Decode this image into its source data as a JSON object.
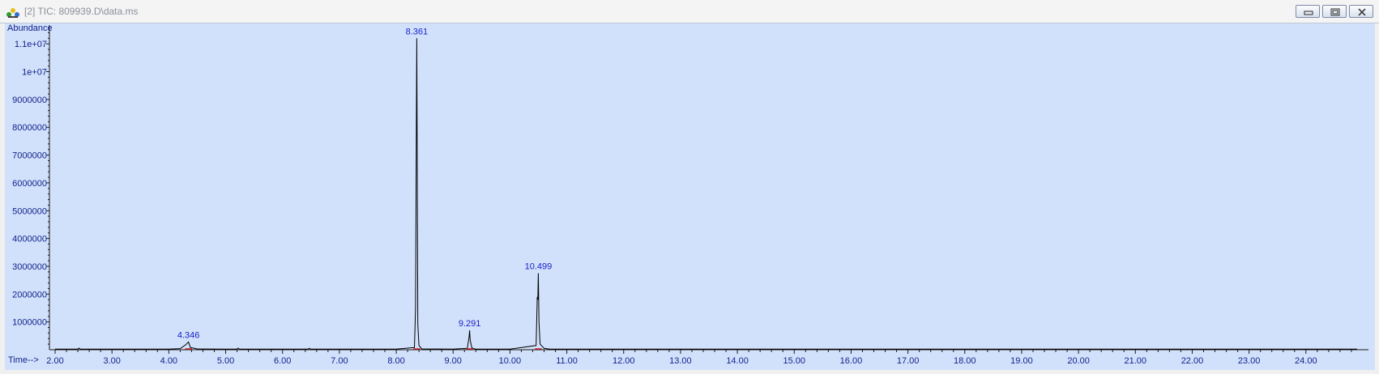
{
  "window": {
    "title": "[2] TIC: 809939.D\\data.ms",
    "minimize_icon": "minimize-icon",
    "restore_icon": "restore-icon",
    "close_icon": "close-icon"
  },
  "colors": {
    "plot_bg": "#d1e1fb",
    "trace": "#000000",
    "axis_text": "#0f1f8a",
    "peak_label": "#1a22c8",
    "baseline_marker": "#d02020"
  },
  "chart_data": {
    "type": "line",
    "title": "",
    "ylabel": "Abundance",
    "xlabel": "Time-->",
    "xlim": [
      1.9,
      25.1
    ],
    "ylim": [
      0,
      11500000
    ],
    "x_ticks": [
      2,
      3,
      4,
      5,
      6,
      7,
      8,
      9,
      10,
      11,
      12,
      13,
      14,
      15,
      16,
      17,
      18,
      19,
      20,
      21,
      22,
      23,
      24
    ],
    "x_tick_labels": [
      "2.00",
      "3.00",
      "4.00",
      "5.00",
      "6.00",
      "7.00",
      "8.00",
      "9.00",
      "10.00",
      "11.00",
      "12.00",
      "13.00",
      "14.00",
      "15.00",
      "16.00",
      "17.00",
      "18.00",
      "19.00",
      "20.00",
      "21.00",
      "22.00",
      "23.00",
      "24.00"
    ],
    "y_ticks": [
      1000000,
      2000000,
      3000000,
      4000000,
      5000000,
      6000000,
      7000000,
      8000000,
      9000000,
      10000000,
      11000000
    ],
    "y_tick_labels": [
      "1000000",
      "2000000",
      "3000000",
      "4000000",
      "5000000",
      "6000000",
      "7000000",
      "8000000",
      "9000000",
      "1e+07",
      "1.1e+07"
    ],
    "peak_labels": [
      {
        "x": 4.346,
        "y": 280000,
        "label": "4.346"
      },
      {
        "x": 8.361,
        "y": 11200000,
        "label": "8.361"
      },
      {
        "x": 9.291,
        "y": 700000,
        "label": "9.291"
      },
      {
        "x": 10.499,
        "y": 2750000,
        "label": "10.499"
      }
    ],
    "series": [
      {
        "x": [
          2.0,
          2.4,
          2.42,
          2.44,
          3.0,
          4.0,
          4.2,
          4.3,
          4.346,
          4.38,
          4.5,
          5.0,
          5.2,
          5.22,
          5.24,
          6.0,
          6.45,
          6.47,
          6.49,
          7.0,
          8.0,
          8.32,
          8.34,
          8.35,
          8.361,
          8.37,
          8.38,
          8.4,
          8.45,
          9.0,
          9.25,
          9.28,
          9.291,
          9.3,
          9.33,
          9.4,
          10.0,
          10.46,
          10.48,
          10.49,
          10.499,
          10.51,
          10.53,
          10.6,
          10.7,
          11.0,
          12.0,
          24.9
        ],
        "y": [
          20000,
          20000,
          60000,
          20000,
          20000,
          20000,
          40000,
          180000,
          280000,
          80000,
          30000,
          20000,
          20000,
          60000,
          20000,
          20000,
          20000,
          50000,
          20000,
          20000,
          20000,
          80000,
          1500000,
          6300000,
          11200000,
          6400000,
          900000,
          150000,
          30000,
          20000,
          50000,
          450000,
          700000,
          350000,
          60000,
          20000,
          20000,
          150000,
          1900000,
          1800000,
          2750000,
          1000000,
          200000,
          50000,
          20000,
          20000,
          20000,
          20000
        ]
      }
    ]
  }
}
